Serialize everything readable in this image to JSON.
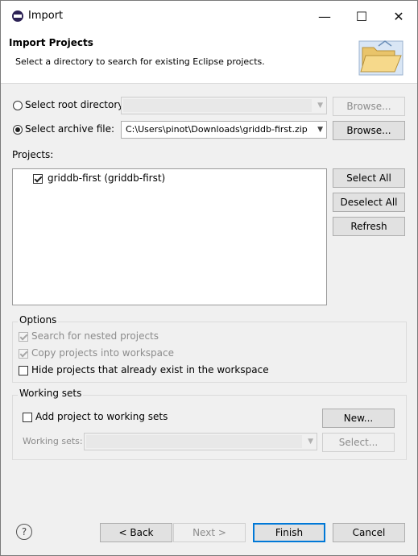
{
  "window": {
    "title": "Import",
    "controls": {
      "minimize": "—",
      "maximize": "☐",
      "close": "✕"
    }
  },
  "banner": {
    "title": "Import Projects",
    "subtitle": "Select a directory to search for existing Eclipse projects.",
    "icon": "folder-open-icon"
  },
  "source": {
    "root_directory": {
      "label": "Select root directory:",
      "selected": false,
      "value": "",
      "browse_label": "Browse...",
      "enabled": false
    },
    "archive_file": {
      "label": "Select archive file:",
      "selected": true,
      "value": "C:\\Users\\pinot\\Downloads\\griddb-first.zip",
      "browse_label": "Browse...",
      "enabled": true
    }
  },
  "projects": {
    "label": "Projects:",
    "items": [
      {
        "label": "griddb-first (griddb-first)",
        "checked": true
      }
    ],
    "buttons": {
      "select_all": "Select All",
      "deselect_all": "Deselect All",
      "refresh": "Refresh"
    }
  },
  "options": {
    "title": "Options",
    "search_nested": {
      "label": "Search for nested projects",
      "checked": true,
      "enabled": false
    },
    "copy_into_workspace": {
      "label": "Copy projects into workspace",
      "checked": true,
      "enabled": false
    },
    "hide_existing": {
      "label": "Hide projects that already exist in the workspace",
      "checked": false,
      "enabled": true
    }
  },
  "working_sets": {
    "title": "Working sets",
    "add_to_working_sets": {
      "label": "Add project to working sets",
      "checked": false
    },
    "new_label": "New...",
    "working_sets_label": "Working sets:",
    "select_label": "Select..."
  },
  "footer": {
    "help_icon": "help-icon",
    "help_glyph": "?",
    "back_label": "< Back",
    "next_label": "Next >",
    "finish_label": "Finish",
    "cancel_label": "Cancel"
  },
  "colors": {
    "accent": "#0078d7",
    "dialog_bg": "#f0f0f0",
    "disabled_text": "#8c8c8c"
  }
}
